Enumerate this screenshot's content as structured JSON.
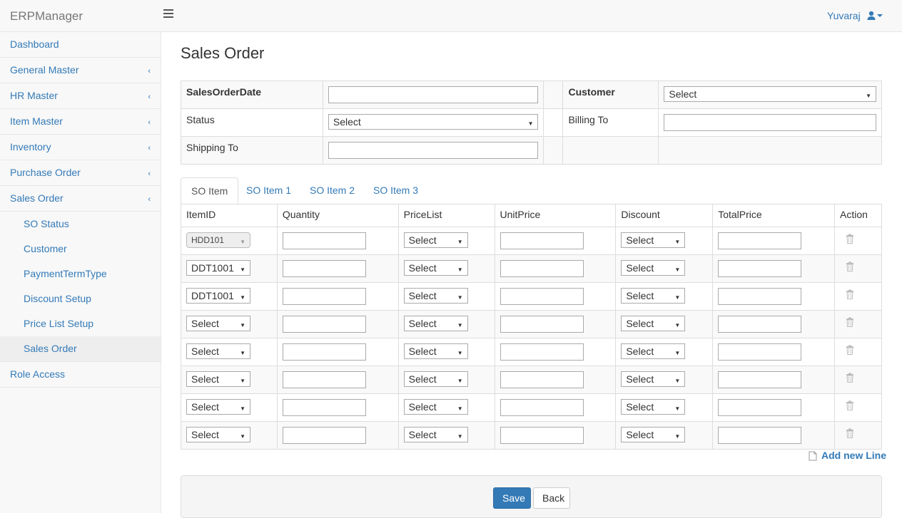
{
  "app": {
    "brand": "ERPManager",
    "user": "Yuvaraj"
  },
  "sidebar": {
    "items": [
      {
        "label": "Dashboard",
        "chevron": false
      },
      {
        "label": "General Master",
        "chevron": true
      },
      {
        "label": "HR Master",
        "chevron": true
      },
      {
        "label": "Item Master",
        "chevron": true
      },
      {
        "label": "Inventory",
        "chevron": true
      },
      {
        "label": "Purchase Order",
        "chevron": true
      },
      {
        "label": "Sales Order",
        "chevron": true
      }
    ],
    "subitems": [
      "SO Status",
      "Customer",
      "PaymentTermType",
      "Discount Setup",
      "Price List Setup",
      "Sales Order"
    ],
    "active_subitem": "Sales Order",
    "after": {
      "label": "Role Access"
    }
  },
  "page": {
    "title": "Sales Order"
  },
  "form": {
    "sales_order_date": {
      "label": "SalesOrderDate",
      "value": ""
    },
    "customer": {
      "label": "Customer",
      "value": "Select"
    },
    "status": {
      "label": "Status",
      "value": "Select"
    },
    "billing_to": {
      "label": "Billing To",
      "value": ""
    },
    "shipping_to": {
      "label": "Shipping To",
      "value": ""
    }
  },
  "tabs": [
    "SO Item",
    "SO Item 1",
    "SO Item 2",
    "SO Item 3"
  ],
  "items_table": {
    "headers": [
      "ItemID",
      "Quantity",
      "PriceList",
      "UnitPrice",
      "Discount",
      "TotalPrice",
      "Action"
    ],
    "rows": [
      {
        "item": "HDD101",
        "disabled": true,
        "pricelist": "Select",
        "discount": "Select"
      },
      {
        "item": "DDT1001",
        "disabled": false,
        "pricelist": "Select",
        "discount": "Select"
      },
      {
        "item": "DDT1001",
        "disabled": false,
        "pricelist": "Select",
        "discount": "Select"
      },
      {
        "item": "Select",
        "disabled": false,
        "pricelist": "Select",
        "discount": "Select"
      },
      {
        "item": "Select",
        "disabled": false,
        "pricelist": "Select",
        "discount": "Select"
      },
      {
        "item": "Select",
        "disabled": false,
        "pricelist": "Select",
        "discount": "Select"
      },
      {
        "item": "Select",
        "disabled": false,
        "pricelist": "Select",
        "discount": "Select"
      },
      {
        "item": "Select",
        "disabled": false,
        "pricelist": "Select",
        "discount": "Select"
      }
    ]
  },
  "actions": {
    "add_line": "Add new Line",
    "save": "Save",
    "back": "Back"
  },
  "colors": {
    "link": "#337ab7",
    "primary": "#337ab7"
  }
}
